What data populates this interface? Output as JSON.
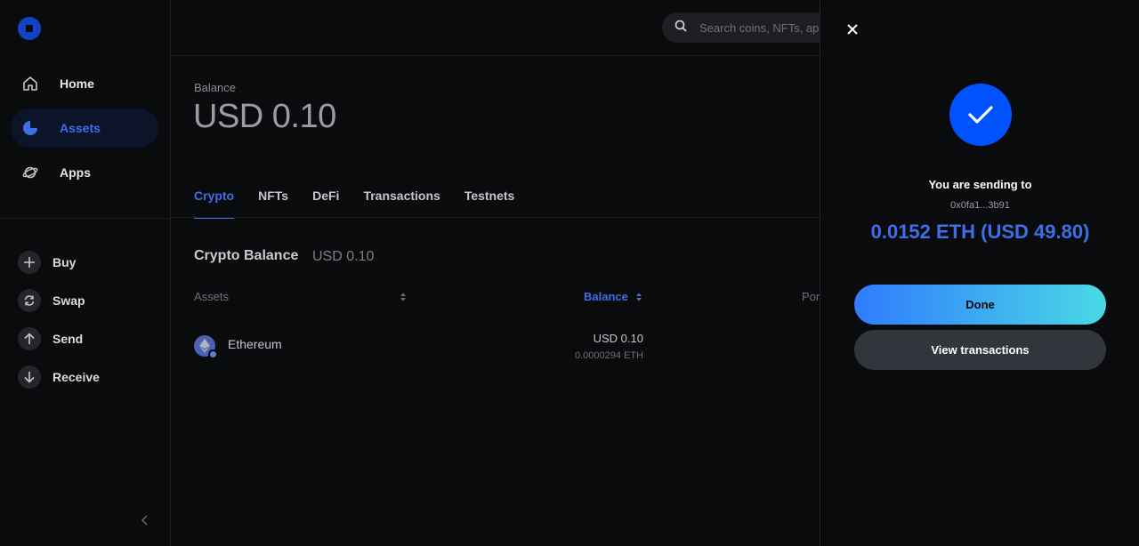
{
  "sidebar": {
    "nav": [
      {
        "label": "Home",
        "icon": "home-icon"
      },
      {
        "label": "Assets",
        "icon": "pie-chart-icon"
      },
      {
        "label": "Apps",
        "icon": "planet-icon"
      }
    ],
    "actions": [
      {
        "label": "Buy",
        "icon": "plus-icon"
      },
      {
        "label": "Swap",
        "icon": "swap-icon"
      },
      {
        "label": "Send",
        "icon": "arrow-up-icon"
      },
      {
        "label": "Receive",
        "icon": "arrow-down-icon"
      }
    ]
  },
  "search": {
    "placeholder": "Search coins, NFTs, apps"
  },
  "balance": {
    "label": "Balance",
    "value": "USD 0.10"
  },
  "tabs": [
    "Crypto",
    "NFTs",
    "DeFi",
    "Transactions",
    "Testnets"
  ],
  "crypto_balance": {
    "title": "Crypto Balance",
    "value": "USD 0.10"
  },
  "table": {
    "headers": {
      "assets": "Assets",
      "balance": "Balance",
      "portfolio": "Por"
    },
    "rows": [
      {
        "name": "Ethereum",
        "usd": "USD 0.10",
        "amount": "0.0000294 ETH"
      }
    ]
  },
  "panel": {
    "sending_label": "You are sending to",
    "address": "0x0fa1...3b91",
    "amount": "0.0152 ETH (USD 49.80)",
    "done_label": "Done",
    "view_label": "View transactions"
  },
  "colors": {
    "accent": "#3e6fe8",
    "brand": "#0052ff",
    "background": "#0a0b0d"
  }
}
